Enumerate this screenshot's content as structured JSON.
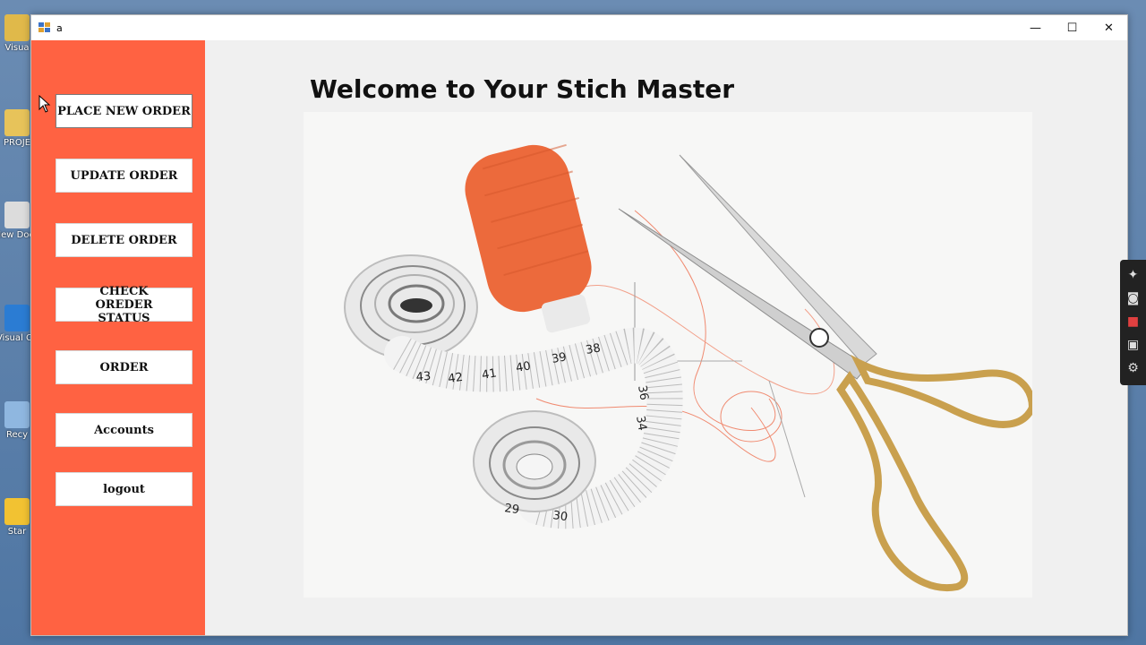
{
  "desktop": {
    "icons": [
      {
        "label": "Visua",
        "color": "#e0b94a"
      },
      {
        "label": "PROJE",
        "color": "#e7c35a"
      },
      {
        "label": "New Docu",
        "color": "#dcdcdc"
      },
      {
        "label": "Visual Co",
        "color": "#2b7cd3"
      },
      {
        "label": "Recy",
        "color": "#8fb7e0"
      },
      {
        "label": "Star",
        "color": "#f2c232"
      }
    ]
  },
  "window": {
    "title": "a",
    "controls": {
      "minimize": "—",
      "maximize": "☐",
      "close": "✕"
    }
  },
  "sidebar": {
    "bg_color": "#ff6242",
    "buttons": [
      {
        "label": "PLACE NEW ORDER"
      },
      {
        "label": "UPDATE ORDER"
      },
      {
        "label": "DELETE ORDER"
      },
      {
        "label": "CHECK OREDER STATUS"
      },
      {
        "label": "ORDER"
      },
      {
        "label": "Accounts"
      },
      {
        "label": "logout"
      }
    ]
  },
  "main": {
    "welcome": "Welcome to Your Stich Master",
    "picture": {
      "tape_numbers": [
        "38",
        "39",
        "40",
        "41",
        "42",
        "43",
        "36",
        "34",
        "29",
        "30"
      ]
    }
  },
  "floating_toolbar": {
    "icons": [
      "pin-icon",
      "camera-icon",
      "video-icon",
      "gallery-icon",
      "settings-icon"
    ]
  }
}
